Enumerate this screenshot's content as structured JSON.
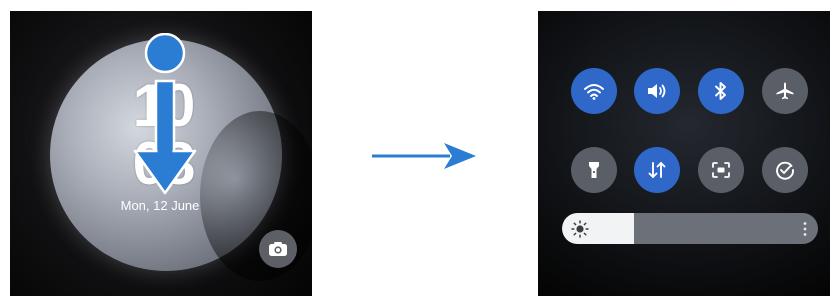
{
  "lock_screen": {
    "time_hours": "10",
    "time_minutes": "08",
    "date": "Mon, 12 June",
    "camera_icon": "camera-icon",
    "gesture": "swipe-down"
  },
  "quick_panel": {
    "row1": [
      {
        "name": "wifi",
        "icon": "wifi-icon",
        "state": "on"
      },
      {
        "name": "sound",
        "icon": "sound-icon",
        "state": "on"
      },
      {
        "name": "bluetooth",
        "icon": "bluetooth-icon",
        "state": "on"
      },
      {
        "name": "airplane",
        "icon": "airplane-icon",
        "state": "off"
      }
    ],
    "row2": [
      {
        "name": "flashlight",
        "icon": "flashlight-icon",
        "state": "off"
      },
      {
        "name": "mobile-data",
        "icon": "data-arrows-icon",
        "state": "on"
      },
      {
        "name": "screen-capture",
        "icon": "screen-capture-icon",
        "state": "off"
      },
      {
        "name": "check",
        "icon": "check-icon",
        "state": "off"
      }
    ],
    "brightness": {
      "level": 0.28,
      "icon": "sun-icon",
      "menu_icon": "more-icon"
    }
  },
  "colors": {
    "tile_on": "#3068c9",
    "tile_off": "#5a5e66",
    "arrow": "#2b7cd3"
  }
}
